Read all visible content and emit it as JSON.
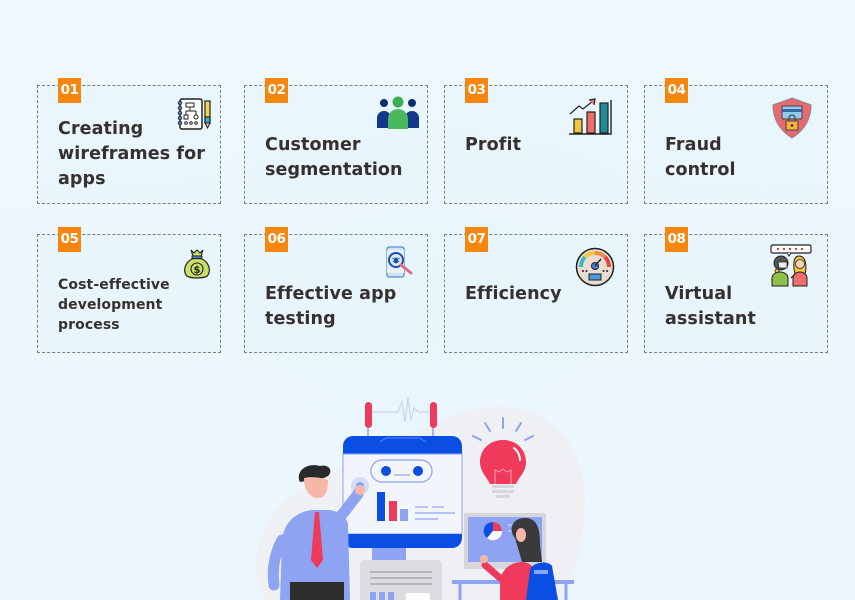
{
  "cards": [
    {
      "number": "01",
      "title_lines": [
        "Creating",
        "wireframes for",
        "apps"
      ],
      "icon": "wireframe-notebook-icon"
    },
    {
      "number": "02",
      "title_lines": [
        "Customer",
        "segmentation"
      ],
      "icon": "customer-group-icon"
    },
    {
      "number": "03",
      "title_lines": [
        "Profit"
      ],
      "icon": "profit-chart-icon"
    },
    {
      "number": "04",
      "title_lines": [
        "Fraud",
        "control"
      ],
      "icon": "shield-lock-icon"
    },
    {
      "number": "05",
      "title_lines": [
        "Cost-effective",
        "development",
        "process"
      ],
      "icon": "money-bag-icon"
    },
    {
      "number": "06",
      "title_lines": [
        "Effective app",
        "testing"
      ],
      "icon": "app-testing-icon"
    },
    {
      "number": "07",
      "title_lines": [
        "Efficiency"
      ],
      "icon": "speedometer-icon"
    },
    {
      "number": "08",
      "title_lines": [
        "Virtual",
        "assistant"
      ],
      "icon": "virtual-assistant-icon"
    }
  ],
  "colors": {
    "badge": "#f7860f",
    "title_text": "#36302f",
    "card_border": "#7a7f86",
    "illus_blue": "#0a4ee4",
    "illus_red": "#f03a5b",
    "illus_light_blue": "#8ea3f2"
  },
  "illustration": {
    "icon": "ai-presentation-illustration"
  }
}
